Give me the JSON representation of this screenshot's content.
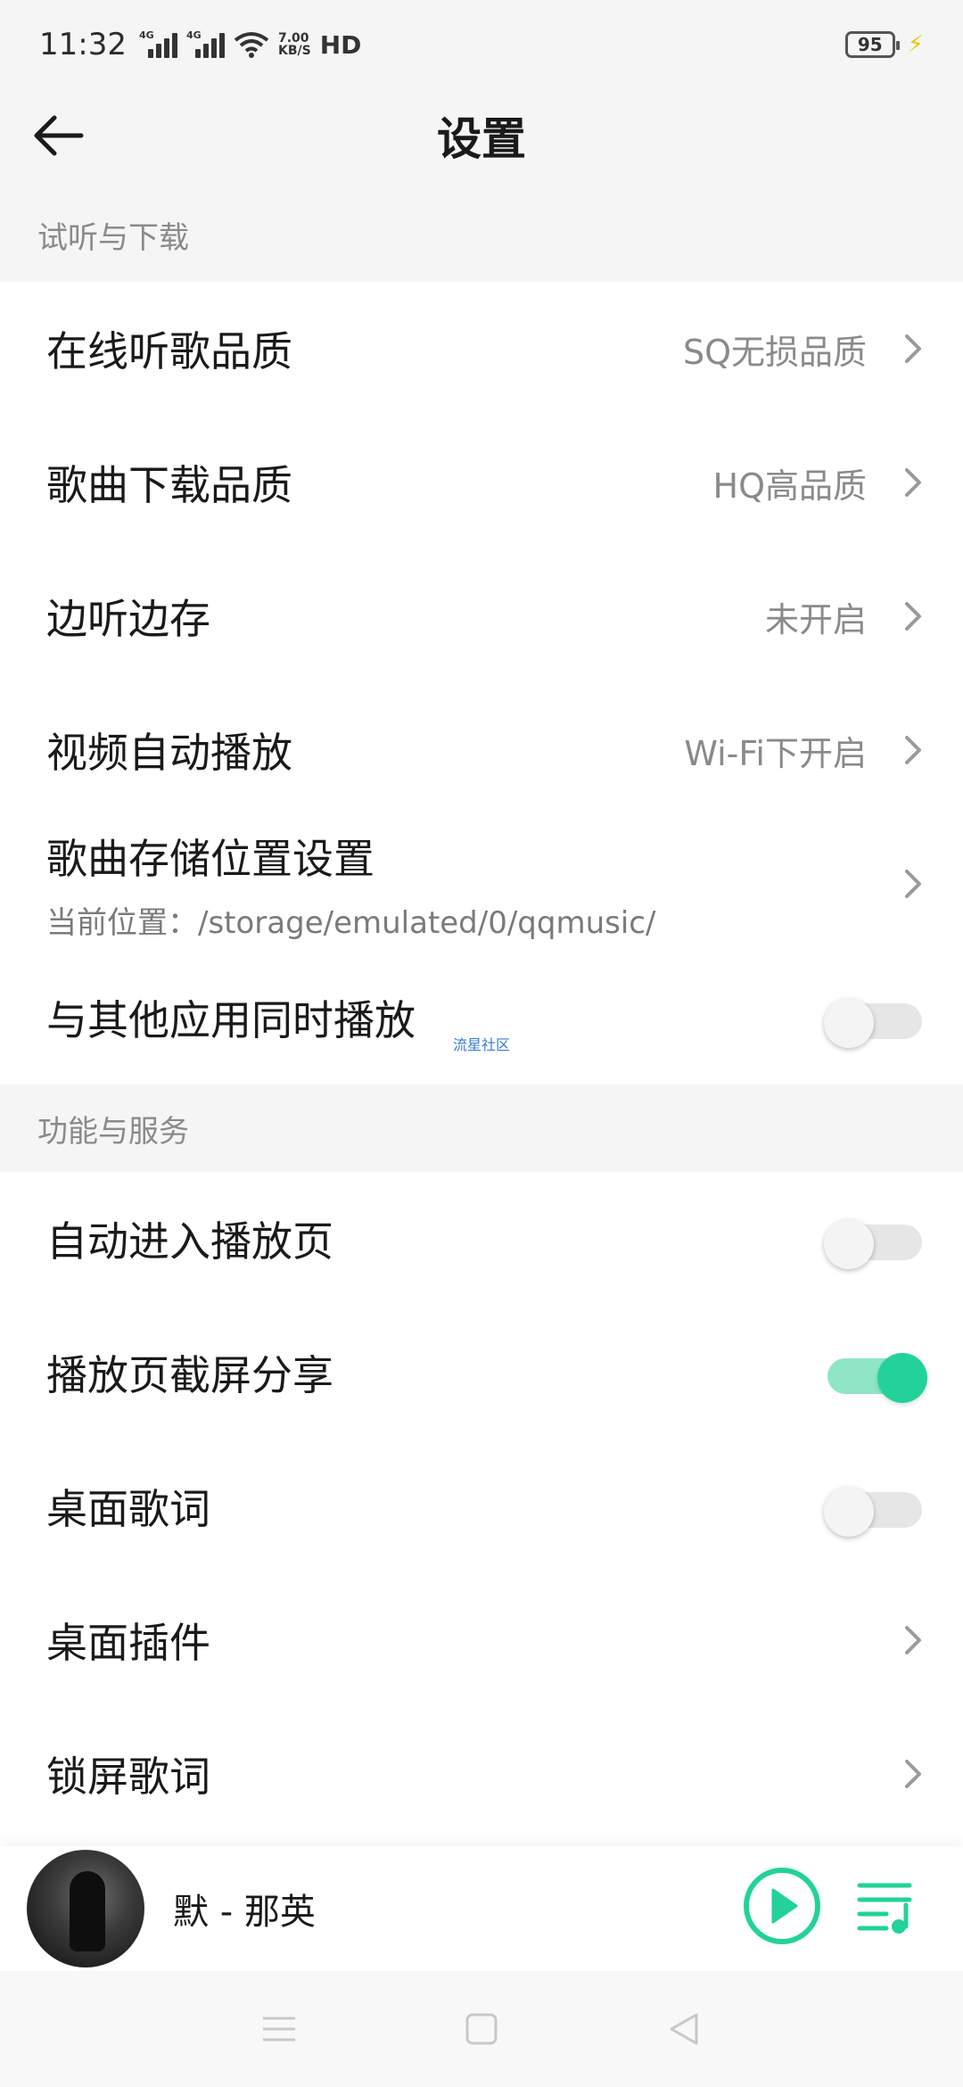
{
  "status_bar": {
    "time": "11:32",
    "network1": "4G",
    "network2": "4G",
    "speed_value": "7.00",
    "speed_unit": "KB/S",
    "hd": "HD",
    "battery": "95"
  },
  "header": {
    "title": "设置"
  },
  "section1": {
    "title": "试听与下载",
    "items": [
      {
        "label": "在线听歌品质",
        "value": "SQ无损品质"
      },
      {
        "label": "歌曲下载品质",
        "value": "HQ高品质"
      },
      {
        "label": "边听边存",
        "value": "未开启"
      },
      {
        "label": "视频自动播放",
        "value": "Wi-Fi下开启"
      },
      {
        "label": "歌曲存储位置设置",
        "sub": "当前位置：/storage/emulated/0/qqmusic/"
      },
      {
        "label": "与其他应用同时播放",
        "toggle": false
      }
    ]
  },
  "watermark": "流星社区",
  "section2": {
    "title": "功能与服务",
    "items": [
      {
        "label": "自动进入播放页",
        "toggle": false
      },
      {
        "label": "播放页截屏分享",
        "toggle": true
      },
      {
        "label": "桌面歌词",
        "toggle": false
      },
      {
        "label": "桌面插件"
      },
      {
        "label": "锁屏歌词"
      }
    ]
  },
  "player": {
    "song": "默 - 那英",
    "accent_color": "#22d29a"
  }
}
